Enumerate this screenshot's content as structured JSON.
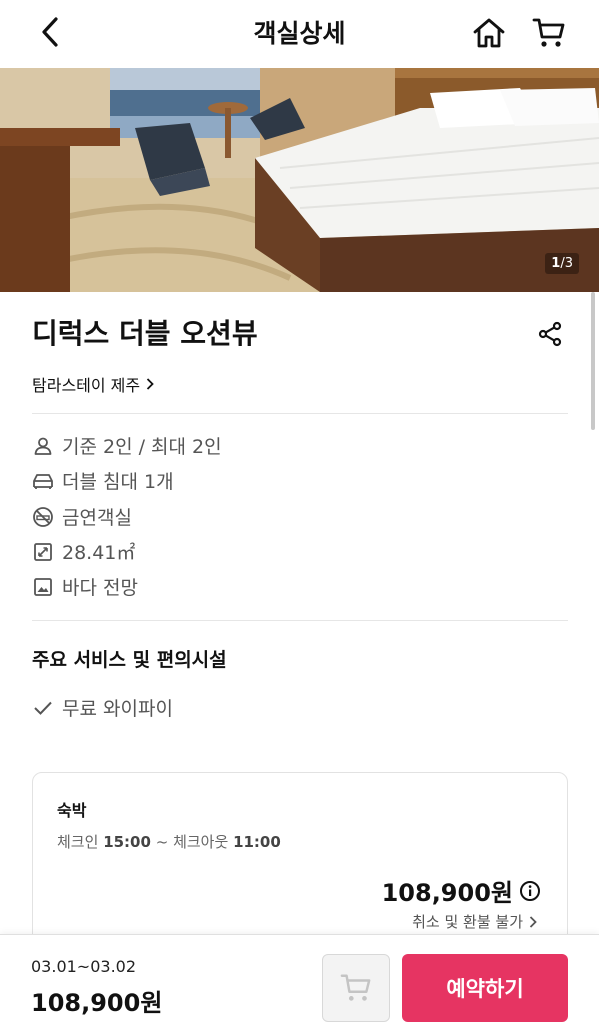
{
  "header": {
    "title": "객실상세",
    "back_icon": "chevron-left-icon",
    "home_icon": "home-icon",
    "cart_icon": "cart-icon"
  },
  "gallery": {
    "current": "1",
    "total": "/3"
  },
  "room": {
    "name": "디럭스 더블 오션뷰",
    "hotel": "탐라스테이 제주",
    "info": [
      {
        "icon": "person-icon",
        "text": "기준 2인 / 최대 2인"
      },
      {
        "icon": "bed-icon",
        "text": "더블 침대 1개"
      },
      {
        "icon": "no-smoking-icon",
        "text": "금연객실"
      },
      {
        "icon": "area-icon",
        "text": "28.41㎡"
      },
      {
        "icon": "view-icon",
        "text": "바다 전망"
      }
    ]
  },
  "services": {
    "title": "주요 서비스 및 편의시설",
    "items": [
      "무료 와이파이"
    ]
  },
  "stay": {
    "label": "숙박",
    "checkin_label": "체크인",
    "checkin_time": "15:00",
    "separator": "~",
    "checkout_label": "체크아웃",
    "checkout_time": "11:00",
    "price": "108,900원",
    "refund": "취소 및 환불 불가"
  },
  "booking": {
    "dates": "03.01~03.02",
    "total": "108,900원",
    "book_label": "예약하기"
  },
  "colors": {
    "accent": "#e63462"
  }
}
